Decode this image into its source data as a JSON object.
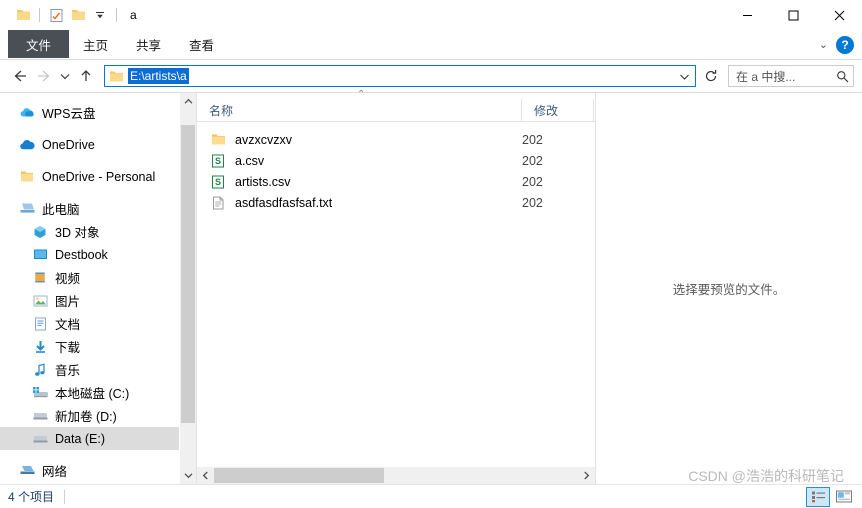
{
  "window": {
    "title": "a",
    "controls": {
      "minimize": "minimize-icon",
      "maximize": "maximize-icon",
      "close": "close-icon"
    }
  },
  "quick_access": {
    "items": [
      {
        "name": "folder-icon",
        "label": ""
      },
      {
        "name": "properties-icon",
        "label": ""
      },
      {
        "name": "new-folder-icon",
        "label": ""
      },
      {
        "name": "customize-dropdown-icon",
        "label": ""
      }
    ]
  },
  "ribbon": {
    "tabs": [
      {
        "label": "文件",
        "active": true
      },
      {
        "label": "主页",
        "active": false
      },
      {
        "label": "共享",
        "active": false
      },
      {
        "label": "查看",
        "active": false
      }
    ],
    "expand_label": "⌄",
    "help_label": "?"
  },
  "navigation": {
    "back_label": "←",
    "forward_label": "→",
    "recent_label": "⌄",
    "up_label": "↑"
  },
  "address": {
    "path": "E:\\artists\\a",
    "dropdown_label": "⌄",
    "refresh_label": "↻"
  },
  "search": {
    "placeholder": "在 a 中搜...",
    "icon": "search-icon"
  },
  "sidebar": {
    "items": [
      {
        "label": "WPS云盘",
        "icon": "wps-cloud-icon",
        "indent": 0,
        "selected": false
      },
      {
        "label": "OneDrive",
        "icon": "onedrive-cloud-icon",
        "indent": 0,
        "selected": false
      },
      {
        "label": "OneDrive - Personal",
        "icon": "folder-icon",
        "indent": 0,
        "selected": false
      },
      {
        "label": "此电脑",
        "icon": "this-pc-icon",
        "indent": 0,
        "selected": false
      },
      {
        "label": "3D 对象",
        "icon": "3d-objects-icon",
        "indent": 1,
        "selected": false
      },
      {
        "label": "Destbook",
        "icon": "desktop-icon",
        "indent": 1,
        "selected": false
      },
      {
        "label": "视频",
        "icon": "videos-icon",
        "indent": 1,
        "selected": false
      },
      {
        "label": "图片",
        "icon": "pictures-icon",
        "indent": 1,
        "selected": false
      },
      {
        "label": "文档",
        "icon": "documents-icon",
        "indent": 1,
        "selected": false
      },
      {
        "label": "下载",
        "icon": "downloads-icon",
        "indent": 1,
        "selected": false
      },
      {
        "label": "音乐",
        "icon": "music-icon",
        "indent": 1,
        "selected": false
      },
      {
        "label": "本地磁盘 (C:)",
        "icon": "windows-drive-icon",
        "indent": 1,
        "selected": false
      },
      {
        "label": "新加卷 (D:)",
        "icon": "drive-icon",
        "indent": 1,
        "selected": false
      },
      {
        "label": "Data (E:)",
        "icon": "drive-icon",
        "indent": 1,
        "selected": true
      },
      {
        "label": "网络",
        "icon": "network-icon",
        "indent": 0,
        "selected": false
      }
    ]
  },
  "filelist": {
    "columns": [
      {
        "label": "名称",
        "key": "name"
      },
      {
        "label": "修改",
        "key": "modified"
      }
    ],
    "sort_indicator": "⌃",
    "rows": [
      {
        "name": "avzxcvzxv",
        "modified": "202",
        "icon": "folder-icon"
      },
      {
        "name": "a.csv",
        "modified": "202",
        "icon": "csv-file-icon"
      },
      {
        "name": "artists.csv",
        "modified": "202",
        "icon": "csv-file-icon"
      },
      {
        "name": "asdfasdfasfsaf.txt",
        "modified": "202",
        "icon": "text-file-icon"
      }
    ]
  },
  "preview": {
    "message": "选择要预览的文件。"
  },
  "statusbar": {
    "item_count": "4 个项目",
    "view_details_icon": "details-view-icon",
    "view_large_icons_icon": "large-icons-view-icon"
  },
  "watermark": {
    "text": "CSDN @浩浩的科研笔记"
  },
  "colors": {
    "accent": "#0078d7",
    "selection": "#0a6cd4",
    "file_tab": "#4a4f55",
    "folder_yellow": "#f7d073",
    "csv_green": "#1d8246"
  }
}
